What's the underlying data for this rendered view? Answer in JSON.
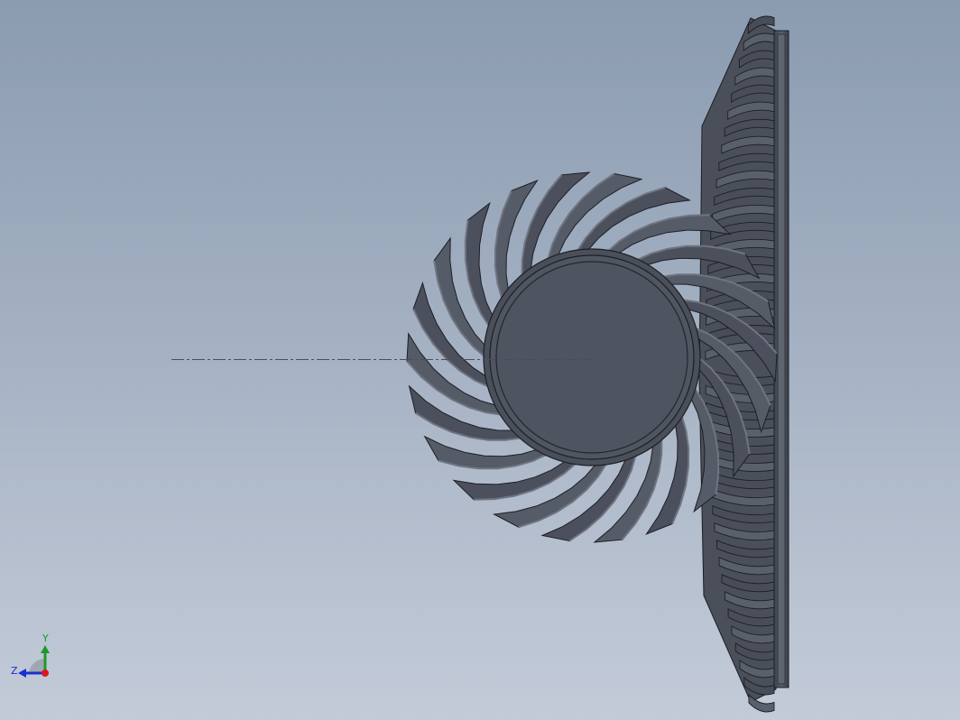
{
  "viewport": {
    "background_top": "#8b9bb0",
    "background_bottom": "#c3cbd8"
  },
  "model": {
    "pinion_teeth": 22,
    "gear_teeth_visible": 40,
    "shaded_color": "#4d535f",
    "edge_color": "#1c1f26"
  },
  "triad": {
    "y_label": "Y",
    "z_label": "Z",
    "y_color": "#1a9a2a",
    "z_color": "#1a2fd0",
    "x_color": "#d81818"
  }
}
